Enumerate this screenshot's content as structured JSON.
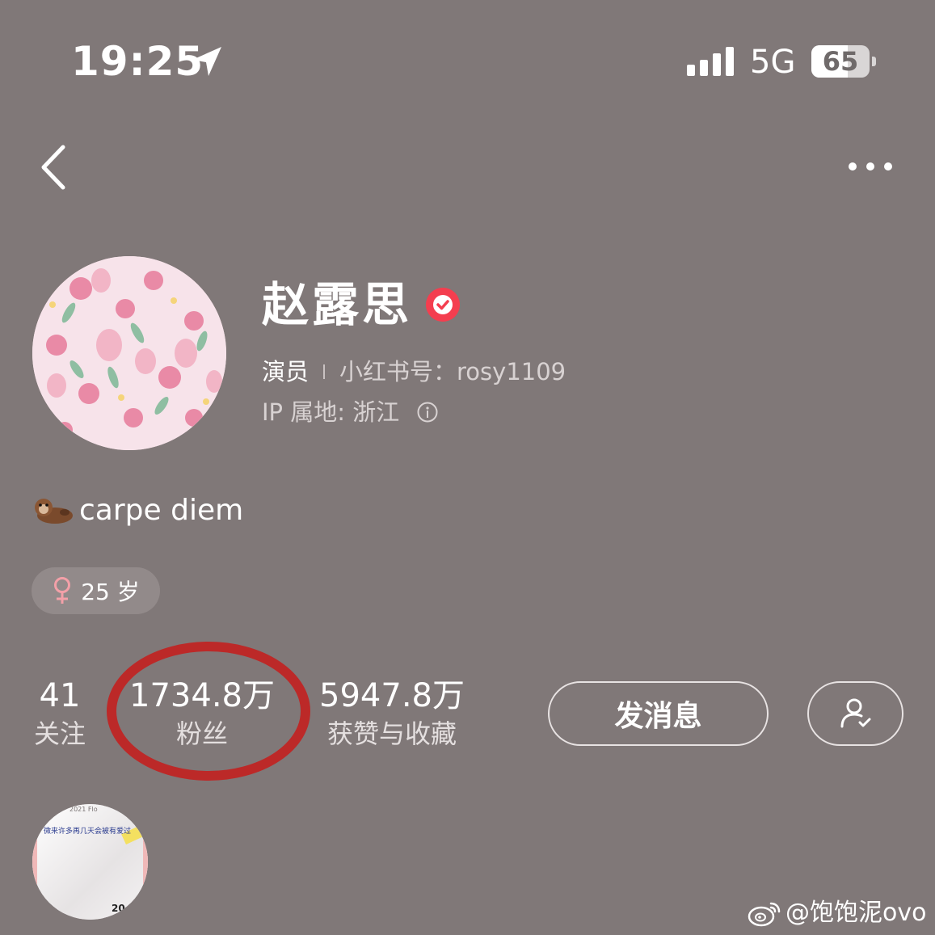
{
  "status_bar": {
    "time": "19:25",
    "network": "5G",
    "battery": "65"
  },
  "nav": {
    "back_icon": "chevron-left-icon",
    "more_icon": "more-dots-icon"
  },
  "profile": {
    "name": "赵露思",
    "occupation": "演员",
    "redbook_id": "小红书号：rosy1109",
    "ip_location": "IP 属地: 浙江",
    "bio": "carpe diem",
    "age_tag": "25 岁"
  },
  "stats": {
    "following": {
      "value": "41",
      "label": "关注"
    },
    "followers": {
      "value": "1734.8万",
      "label": "粉丝"
    },
    "likes": {
      "value": "5947.8万",
      "label": "获赞与收藏"
    }
  },
  "actions": {
    "message_label": "发消息"
  },
  "highlight": {
    "top_text": "2021 Flo",
    "title": "微来许多再几天会被有爱过",
    "year": "20"
  },
  "watermark": {
    "text": "@饱饱泥ovo"
  },
  "colors": {
    "background": "#807878",
    "verified": "#f43e4f",
    "female": "#f3a0a8",
    "ring": "#c2201f"
  }
}
